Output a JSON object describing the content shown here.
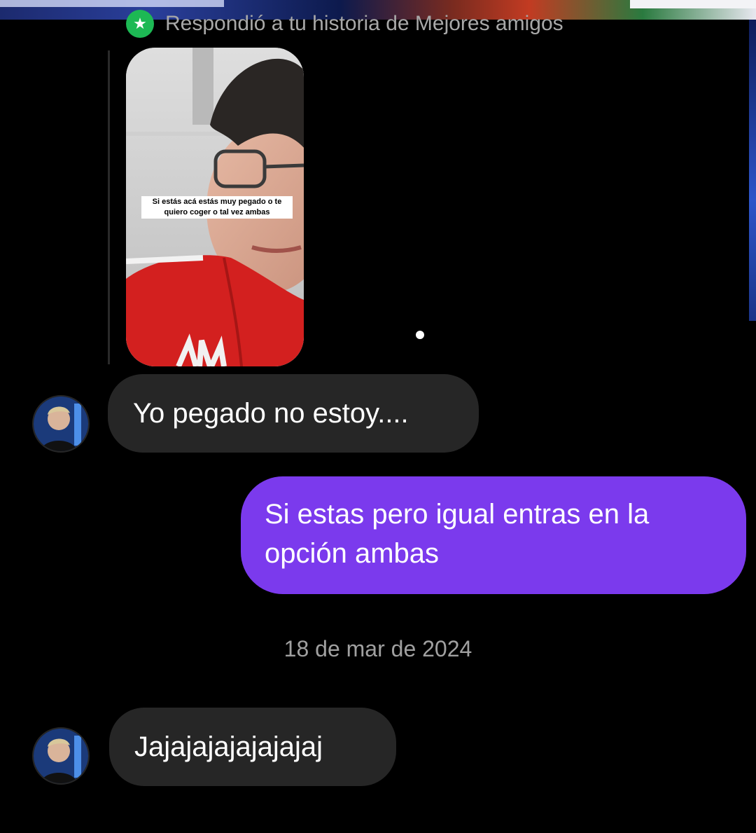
{
  "reply_header": {
    "text": "Respondió a tu historia de Mejores amigos",
    "icon": "star-icon",
    "badge_color": "#1db954"
  },
  "story": {
    "caption": "Si estás acá estás muy pegado o te quiero coger o tal vez ambas"
  },
  "messages": [
    {
      "sender": "other",
      "text": "Yo pegado no estoy...."
    },
    {
      "sender": "me",
      "text": "Si estas pero igual entras en la opción ambas"
    },
    {
      "sender": "other",
      "text": "Jajajajajajajajaj"
    }
  ],
  "timestamp": "18 de mar de 2024",
  "colors": {
    "background": "#000000",
    "received_bubble": "#262626",
    "sent_bubble": "#7b3aed",
    "text": "#ffffff",
    "muted_text": "#a0a0a0"
  }
}
